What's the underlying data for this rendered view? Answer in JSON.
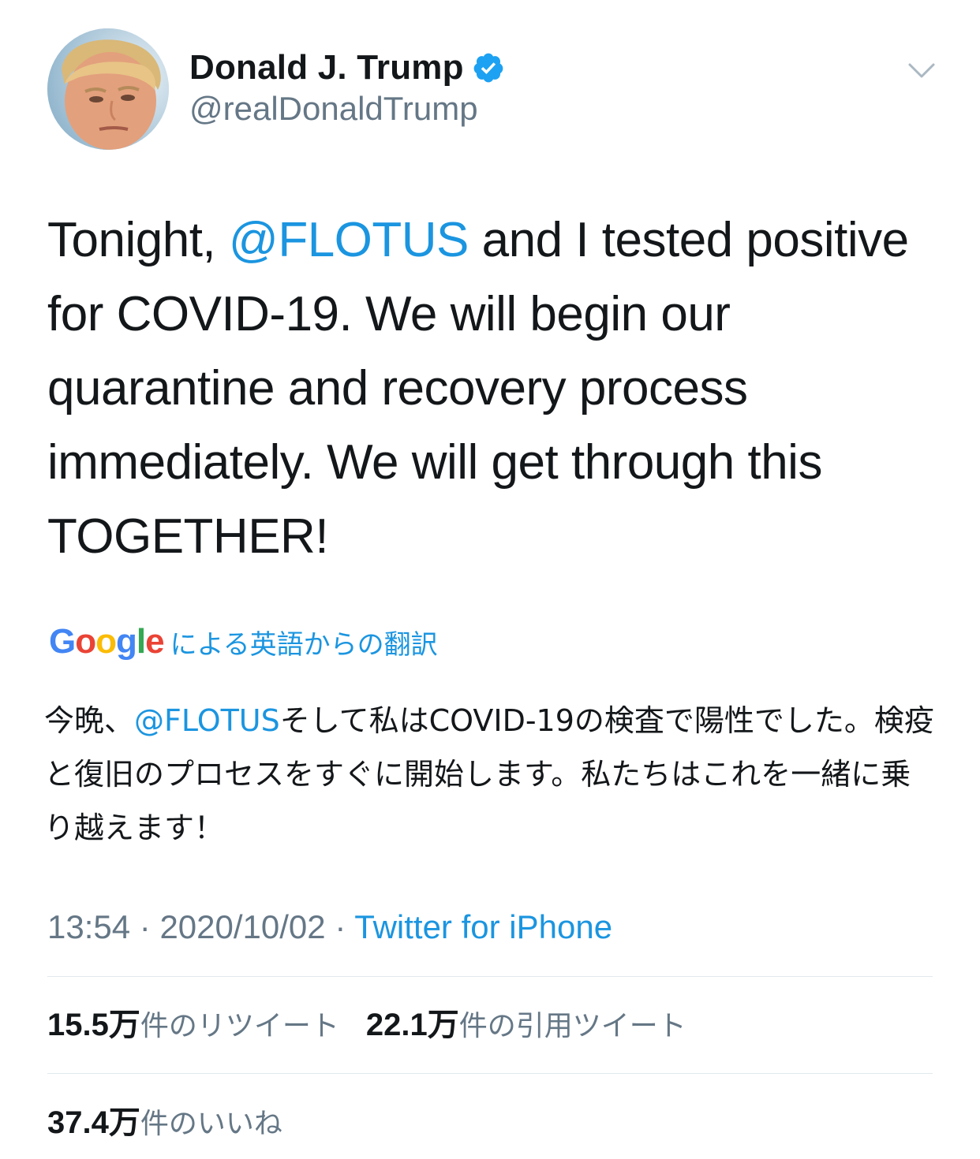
{
  "user": {
    "display_name": "Donald J. Trump",
    "handle": "@realDonaldTrump",
    "verified": true
  },
  "tweet": {
    "text_before_mention": "Tonight, ",
    "mention": "@FLOTUS",
    "text_after_mention": " and I tested positive for COVID-19. We will begin our quarantine and recovery process immediately. We will get through this TOGETHER!"
  },
  "translation": {
    "provider_logo": {
      "letters": [
        {
          "ch": "G",
          "color": "blue"
        },
        {
          "ch": "o",
          "color": "red"
        },
        {
          "ch": "o",
          "color": "yellow"
        },
        {
          "ch": "g",
          "color": "blue"
        },
        {
          "ch": "l",
          "color": "green"
        },
        {
          "ch": "e",
          "color": "red"
        }
      ]
    },
    "label": "による英語からの翻訳",
    "text_before_mention": "今晩、",
    "mention": "@FLOTUS",
    "text_after_mention": "そして私はCOVID-19の検査で陽性でした。検疫と復旧のプロセスをすぐに開始します。私たちはこれを一緒に乗り越えます！"
  },
  "meta": {
    "time": "13:54",
    "separator": " · ",
    "date": "2020/10/02",
    "source": "Twitter for iPhone"
  },
  "stats": {
    "retweets_count": "15.5万",
    "retweets_label": "件のリツイート",
    "quotes_count": "22.1万",
    "quotes_label": "件の引用ツイート",
    "likes_count": "37.4万",
    "likes_label": "件のいいね"
  },
  "colors": {
    "link": "#1b95e0",
    "text": "#14171a",
    "secondary": "#657786",
    "divider": "#e1e8ed",
    "google_blue": "#4285f4",
    "google_red": "#ea4335",
    "google_yellow": "#fbbc05",
    "google_green": "#34a853"
  },
  "icons": {
    "verified": "verified-badge-icon",
    "caret": "chevron-down-icon"
  }
}
